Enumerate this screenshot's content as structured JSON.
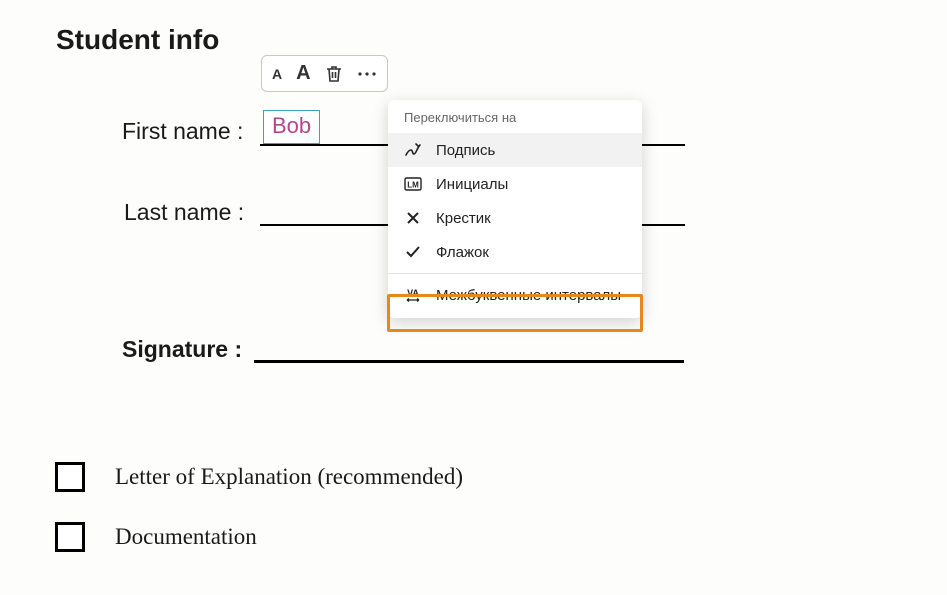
{
  "title": "Student info",
  "fields": {
    "first_name_label": "First name :",
    "first_name_value": "Bob",
    "last_name_label": "Last name :",
    "signature_label": "Signature :"
  },
  "dropdown": {
    "header": "Переключиться на",
    "items": {
      "signature": "Подпись",
      "initials": "Инициалы",
      "cross": "Крестик",
      "check": "Флажок",
      "spacing": "Межбуквенные интервалы"
    }
  },
  "checkboxes": {
    "letter": "Letter of Explanation (recommended)",
    "docs": "Documentation"
  }
}
